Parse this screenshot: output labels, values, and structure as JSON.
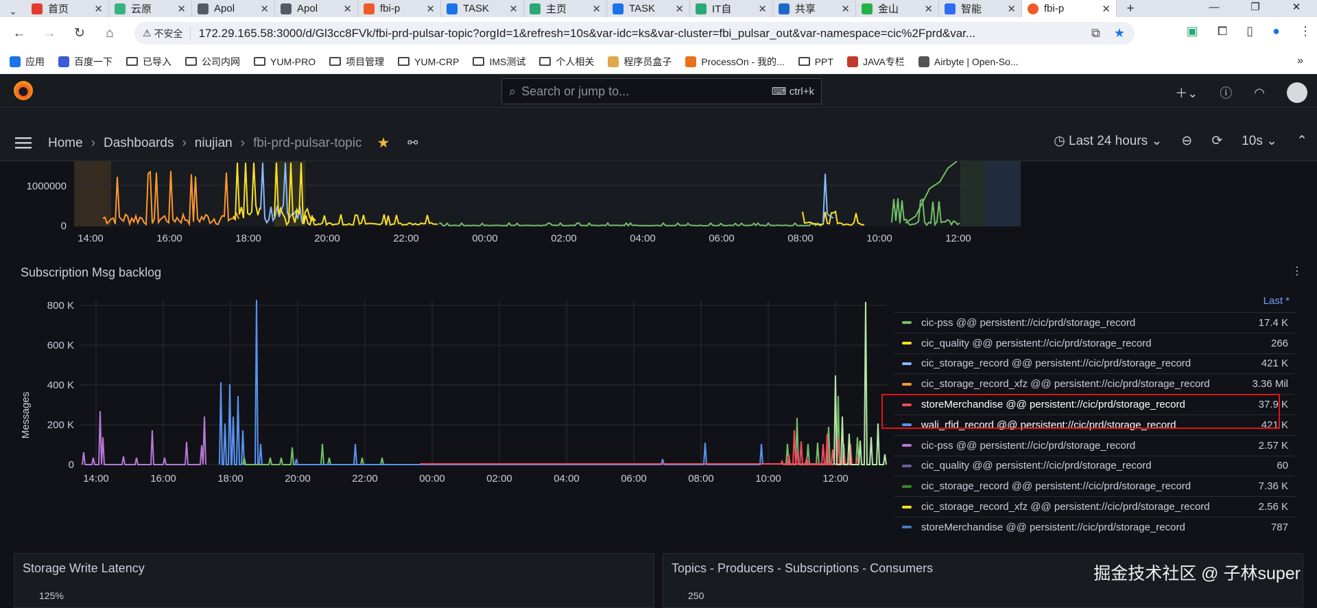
{
  "browser": {
    "tabs": [
      {
        "title": "首页",
        "color": "#e33b2e"
      },
      {
        "title": "云原",
        "color": "#36b37e"
      },
      {
        "title": "Apol",
        "color": "#555b64"
      },
      {
        "title": "Apol",
        "color": "#555b64"
      },
      {
        "title": "fbi-p",
        "color": "#f05a28"
      },
      {
        "title": "TASK",
        "color": "#1a73e8"
      },
      {
        "title": "主页",
        "color": "#2aa876"
      },
      {
        "title": "TASK",
        "color": "#1a73e8"
      },
      {
        "title": "IT自",
        "color": "#2aa876"
      },
      {
        "title": "共享",
        "color": "#1b6ac9"
      },
      {
        "title": "金山",
        "color": "#27b148"
      },
      {
        "title": "智能",
        "color": "#2c6cf6"
      }
    ],
    "active_tab": {
      "title": "fbi-p",
      "color": "#f05a28"
    },
    "new_tab_label": "+",
    "window_controls": [
      "—",
      "❐",
      "✕"
    ],
    "security_label": "不安全",
    "url": "172.29.165.58:3000/d/Gl3cc8FVk/fbi-prd-pulsar-topic?orgId=1&refresh=10s&var-idc=ks&var-cluster=fbi_pulsar_out&var-namespace=cic%2Fprd&var...",
    "bookmarks": [
      "应用",
      "百度一下",
      "已导入",
      "公司内网",
      "YUM-PRO",
      "项目管理",
      "YUM-CRP",
      "IMS测试",
      "个人相关",
      "程序员盒子",
      "ProcessOn - 我的...",
      "PPT",
      "JAVA专栏",
      "Airbyte | Open-So..."
    ]
  },
  "grafana": {
    "search_placeholder": "Search or jump to...",
    "search_shortcut": "ctrl+k",
    "breadcrumb": [
      "Home",
      "Dashboards",
      "niujian",
      "fbi-prd-pulsar-topic"
    ],
    "time_range": "Last 24 hours",
    "refresh_interval": "10s",
    "top_chart": {
      "y_ticks": [
        "1000000",
        "0"
      ],
      "x_ticks": [
        "14:00",
        "16:00",
        "18:00",
        "20:00",
        "22:00",
        "00:00",
        "02:00",
        "04:00",
        "06:00",
        "08:00",
        "10:00",
        "12:00"
      ]
    },
    "backlog_panel": {
      "title": "Subscription Msg backlog",
      "ylabel": "Messages",
      "y_ticks": [
        "800 K",
        "600 K",
        "400 K",
        "200 K",
        "0"
      ],
      "x_ticks": [
        "14:00",
        "16:00",
        "18:00",
        "20:00",
        "22:00",
        "00:00",
        "02:00",
        "04:00",
        "06:00",
        "08:00",
        "10:00",
        "12:00"
      ],
      "legend_header": "Last *",
      "legend": [
        {
          "name": "cic-pss @@ persistent://cic/prd/storage_record",
          "value": "17.4 K",
          "color": "#73bf69"
        },
        {
          "name": "cic_quality @@ persistent://cic/prd/storage_record",
          "value": "266",
          "color": "#fade2a"
        },
        {
          "name": "cic_storage_record @@ persistent://cic/prd/storage_record",
          "value": "421 K",
          "color": "#8ab8ff"
        },
        {
          "name": "cic_storage_record_xfz @@ persistent://cic/prd/storage_record",
          "value": "3.36 Mil",
          "color": "#ff9830"
        },
        {
          "name": "storeMerchandise @@ persistent://cic/prd/storage_record",
          "value": "37.9 K",
          "color": "#f2495c"
        },
        {
          "name": "wali_rfid_record @@ persistent://cic/prd/storage_record",
          "value": "421 K",
          "color": "#5794f2"
        },
        {
          "name": "cic-pss @@ persistent://cic/prd/storage_record",
          "value": "2.57 K",
          "color": "#b877d9"
        },
        {
          "name": "cic_quality @@ persistent://cic/prd/storage_record",
          "value": "60",
          "color": "#705da0"
        },
        {
          "name": "cic_storage_record @@ persistent://cic/prd/storage_record",
          "value": "7.36 K",
          "color": "#37872d"
        },
        {
          "name": "cic_storage_record_xfz @@ persistent://cic/prd/storage_record",
          "value": "2.56 K",
          "color": "#fade2a"
        },
        {
          "name": "storeMerchandise @@ persistent://cic/prd/storage_record",
          "value": "787",
          "color": "#447ebc"
        }
      ]
    },
    "bottom_panels": [
      {
        "title": "Storage Write Latency",
        "tick": "125%"
      },
      {
        "title": "Topics - Producers - Subscriptions - Consumers",
        "tick": "250"
      }
    ],
    "watermark": "掘金技术社区 @ 子林super"
  }
}
